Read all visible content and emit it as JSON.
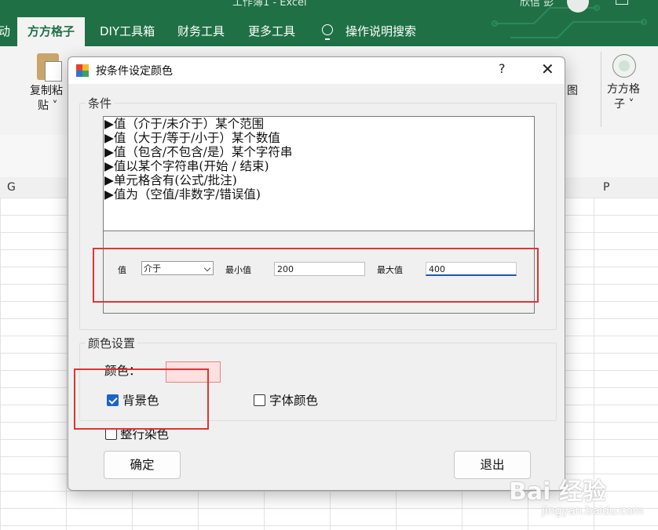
{
  "excel": {
    "title": "工作簿1 - Excel",
    "user": "欣信 彭",
    "tabs": [
      "动",
      "方方格子",
      "DIY工具箱",
      "财务工具",
      "更多工具",
      "操作说明搜索"
    ],
    "ribbon": {
      "paste_label_1": "复制粘",
      "paste_label_2": "贴 ˅",
      "partial_label_1": "图",
      "fang_label_1": "方方格",
      "fang_label_2": "子 ˅"
    },
    "columns": {
      "g": "G",
      "p": "P"
    },
    "accent": "#1f7145"
  },
  "dialog": {
    "title": "按条件设定颜色",
    "help": "?",
    "close": "✕",
    "condition_group": "条件",
    "conditions": [
      "▶值（介于/未介于）某个范围",
      "▶值（大于/等于/小于）某个数值",
      "▶值（包含/不包含/是）某个字符串",
      "▶值以某个字符串(开始 / 结束)",
      "▶单元格含有(公式/批注)",
      "▶值为（空值/非数字/错误值)"
    ],
    "value_label": "值",
    "value_select": "介于",
    "min_label": "最小值",
    "min_value": "200",
    "max_label": "最大值",
    "max_value": "400",
    "color_group": "颜色设置",
    "color_label": "颜色：",
    "color_swatch": "#fde0e0",
    "bg_checkbox": "背景色",
    "bg_checked": true,
    "font_checkbox": "字体颜色",
    "font_checked": false,
    "row_checkbox": "整行染色",
    "row_checked": false,
    "ok": "确定",
    "exit": "退出"
  },
  "watermark": {
    "main": "Bai 经验",
    "sub": "jingyan.baidu.com"
  }
}
